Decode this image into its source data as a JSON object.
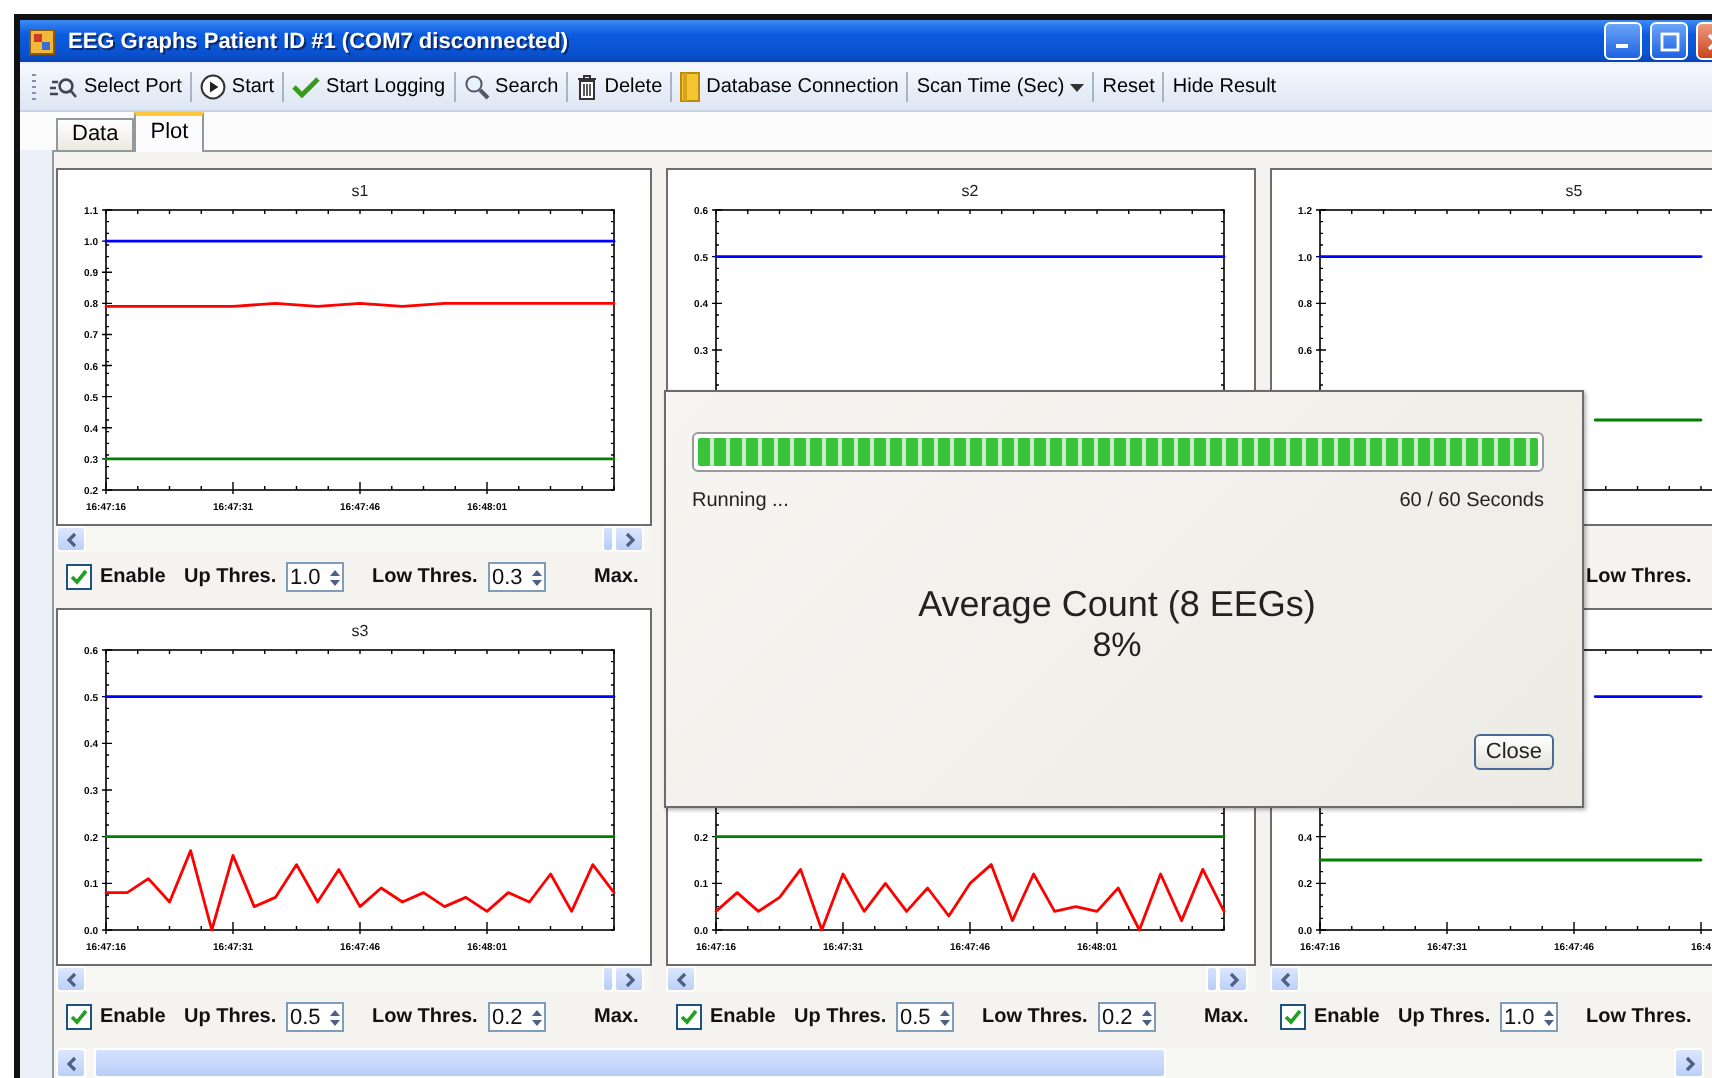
{
  "window": {
    "title": "EEG Graphs Patient ID #1 (COM7 disconnected)"
  },
  "toolbar": [
    {
      "kind": "port",
      "label": "Select Port"
    },
    {
      "kind": "start",
      "label": "Start"
    },
    {
      "kind": "logging",
      "label": "Start Logging"
    },
    {
      "kind": "search",
      "label": "Search"
    },
    {
      "kind": "delete",
      "label": "Delete"
    },
    {
      "kind": "database",
      "label": "Database Connection"
    },
    {
      "kind": "dropdown",
      "label": "Scan Time (Sec)"
    },
    {
      "kind": "text",
      "label": "Reset"
    },
    {
      "kind": "text",
      "label": "Hide Result"
    }
  ],
  "tabs": [
    {
      "label": "Data",
      "selected": false
    },
    {
      "label": "Plot",
      "selected": true
    }
  ],
  "plots": [
    {
      "chart_data": {
        "type": "line",
        "title": "s1",
        "categories": [
          "16:47:16",
          null,
          null,
          "16:47:31",
          null,
          null,
          "16:47:46",
          null,
          null,
          "16:48:01",
          null,
          null,
          null
        ],
        "ylim": [
          0.2,
          1.1
        ],
        "yticks": [
          {
            "value": 0.2,
            "label": "0.2"
          },
          {
            "value": 0.3,
            "label": "0.3"
          },
          {
            "value": 0.4,
            "label": "0.4"
          },
          {
            "value": 0.5,
            "label": "0.5"
          },
          {
            "value": 0.6,
            "label": "0.6"
          },
          {
            "value": 0.7,
            "label": "0.7"
          },
          {
            "value": 0.8,
            "label": "0.8"
          },
          {
            "value": 0.9,
            "label": "0.9"
          },
          {
            "value": 1.0,
            "label": "1.0"
          },
          {
            "value": 1.1,
            "label": "1.1"
          }
        ],
        "series": [
          {
            "color": "#0000ff",
            "values": [
              1.0,
              1.0,
              1.0,
              1.0,
              1.0,
              1.0,
              1.0,
              1.0,
              1.0,
              1.0,
              1.0,
              1.0,
              1.0
            ]
          },
          {
            "color": "#008000",
            "values": [
              0.3,
              0.3,
              0.3,
              0.3,
              0.3,
              0.3,
              0.3,
              0.3,
              0.3,
              0.3,
              0.3,
              0.3,
              0.3
            ]
          },
          {
            "color": "#ff0000",
            "values": [
              0.79,
              0.79,
              0.79,
              0.79,
              0.8,
              0.79,
              0.8,
              0.79,
              0.8,
              0.8,
              0.8,
              0.8,
              0.8
            ]
          }
        ]
      },
      "controls": {
        "enable": {
          "label": "Enable",
          "checked": true
        },
        "up": {
          "label": "Up Thres.",
          "value": "1.0"
        },
        "low": {
          "label": "Low Thres.",
          "value": "0.3"
        },
        "max_label": "Max."
      }
    },
    {
      "chart_data": {
        "type": "line",
        "title": "s2",
        "categories": [
          null,
          null,
          null,
          null,
          null,
          null,
          null,
          null,
          null,
          null,
          null,
          null,
          null
        ],
        "ylim": [
          0,
          0.6
        ],
        "yticks": [
          {
            "value": 0.3,
            "label": "0.3"
          },
          {
            "value": 0.4,
            "label": "0.4"
          },
          {
            "value": 0.5,
            "label": "0.5"
          },
          {
            "value": 0.6,
            "label": "0.6"
          }
        ],
        "series": [
          {
            "color": "#0000ff",
            "values": [
              0.5,
              0.5,
              0.5,
              0.5,
              0.5,
              0.5,
              0.5,
              0.5,
              0.5,
              0.5,
              0.5,
              0.5,
              0.5
            ]
          }
        ]
      }
    },
    {
      "chart_data": {
        "type": "line",
        "title": "s5",
        "categories": [
          null,
          null,
          null,
          null,
          null,
          null,
          null,
          null,
          null,
          null,
          null,
          null,
          null,
          null,
          null,
          null,
          null,
          null,
          null,
          null,
          null,
          null,
          null,
          null,
          null
        ],
        "ylim": [
          0,
          1.2
        ],
        "yticks": [
          {
            "value": 0.6,
            "label": "0.6"
          },
          {
            "value": 0.8,
            "label": "0.8"
          },
          {
            "value": 1.0,
            "label": "1.0"
          },
          {
            "value": 1.2,
            "label": "1.2"
          }
        ],
        "series": [
          {
            "color": "#0000ff",
            "values": [
              1.0,
              1.0,
              1.0,
              1.0,
              1.0,
              1.0,
              1.0,
              1.0,
              1.0,
              1.0,
              1.0,
              1.0,
              1.0,
              1.0,
              1.0,
              1.0,
              1.0,
              1.0,
              1.0,
              null,
              null,
              null,
              null,
              null,
              null
            ]
          },
          {
            "color": "#008000",
            "values": [
              null,
              null,
              null,
              null,
              null,
              null,
              null,
              null,
              null,
              null,
              null,
              null,
              null,
              0.3,
              0.3,
              0.3,
              0.3,
              0.3,
              0.3,
              null,
              null,
              null,
              null,
              null,
              null
            ]
          }
        ]
      },
      "controls": {
        "low": {
          "label": "Low Thres."
        }
      }
    },
    {
      "chart_data": {
        "type": "line",
        "title": "s3",
        "categories": [
          "16:47:16",
          null,
          null,
          null,
          null,
          null,
          "16:47:31",
          null,
          null,
          null,
          null,
          null,
          "16:47:46",
          null,
          null,
          null,
          null,
          null,
          "16:48:01",
          null,
          null,
          null,
          null,
          null,
          null
        ],
        "ylim": [
          0,
          0.6
        ],
        "yticks": [
          {
            "value": 0,
            "label": "0.0"
          },
          {
            "value": 0.1,
            "label": "0.1"
          },
          {
            "value": 0.2,
            "label": "0.2"
          },
          {
            "value": 0.3,
            "label": "0.3"
          },
          {
            "value": 0.4,
            "label": "0.4"
          },
          {
            "value": 0.5,
            "label": "0.5"
          },
          {
            "value": 0.6,
            "label": "0.6"
          }
        ],
        "series": [
          {
            "color": "#0000ff",
            "values": [
              0.5,
              0.5,
              0.5,
              0.5,
              0.5,
              0.5,
              0.5,
              0.5,
              0.5,
              0.5,
              0.5,
              0.5,
              0.5,
              0.5,
              0.5,
              0.5,
              0.5,
              0.5,
              0.5,
              0.5,
              0.5,
              0.5,
              0.5,
              0.5,
              0.5
            ]
          },
          {
            "color": "#008000",
            "values": [
              0.2,
              0.2,
              0.2,
              0.2,
              0.2,
              0.2,
              0.2,
              0.2,
              0.2,
              0.2,
              0.2,
              0.2,
              0.2,
              0.2,
              0.2,
              0.2,
              0.2,
              0.2,
              0.2,
              0.2,
              0.2,
              0.2,
              0.2,
              0.2,
              0.2
            ]
          },
          {
            "color": "#ff0000",
            "values": [
              0.08,
              0.08,
              0.11,
              0.06,
              0.17,
              0.0,
              0.16,
              0.05,
              0.07,
              0.14,
              0.06,
              0.13,
              0.05,
              0.09,
              0.06,
              0.08,
              0.05,
              0.07,
              0.04,
              0.08,
              0.06,
              0.12,
              0.04,
              0.14,
              0.08
            ]
          }
        ]
      },
      "controls": {
        "enable": {
          "label": "Enable",
          "checked": true
        },
        "up": {
          "label": "Up Thres.",
          "value": "0.5"
        },
        "low": {
          "label": "Low Thres.",
          "value": "0.2"
        },
        "max_label": "Max."
      }
    },
    {
      "chart_data": {
        "type": "line",
        "categories": [
          "16:47:16",
          null,
          null,
          null,
          null,
          null,
          "16:47:31",
          null,
          null,
          null,
          null,
          null,
          "16:47:46",
          null,
          null,
          null,
          null,
          null,
          "16:48:01",
          null,
          null,
          null,
          null,
          null,
          null
        ],
        "ylim": [
          0,
          0.6
        ],
        "yticks": [
          {
            "value": 0,
            "label": "0.0"
          },
          {
            "value": 0.1,
            "label": "0.1"
          },
          {
            "value": 0.2,
            "label": "0.2"
          }
        ],
        "series": [
          {
            "color": "#008000",
            "values": [
              0.2,
              0.2,
              0.2,
              0.2,
              0.2,
              0.2,
              0.2,
              0.2,
              0.2,
              0.2,
              0.2,
              0.2,
              0.2,
              0.2,
              0.2,
              0.2,
              0.2,
              0.2,
              0.2,
              0.2,
              0.2,
              0.2,
              0.2,
              0.2,
              0.2
            ]
          },
          {
            "color": "#ff0000",
            "values": [
              0.04,
              0.08,
              0.04,
              0.07,
              0.13,
              0.0,
              0.12,
              0.04,
              0.1,
              0.04,
              0.09,
              0.03,
              0.1,
              0.14,
              0.02,
              0.12,
              0.04,
              0.05,
              0.04,
              0.09,
              0.0,
              0.12,
              0.02,
              0.13,
              0.04
            ]
          }
        ]
      },
      "controls": {
        "enable": {
          "label": "Enable",
          "checked": true
        },
        "up": {
          "label": "Up Thres.",
          "value": "0.5"
        },
        "low": {
          "label": "Low Thres.",
          "value": "0.2"
        },
        "max_label": "Max."
      }
    },
    {
      "chart_data": {
        "type": "line",
        "categories": [
          "16:47:16",
          null,
          null,
          null,
          null,
          null,
          "16:47:31",
          null,
          null,
          null,
          null,
          null,
          "16:47:46",
          null,
          null,
          null,
          null,
          null,
          "16:4",
          null,
          null,
          null,
          null,
          null,
          null
        ],
        "ylim": [
          0,
          1.2
        ],
        "yticks": [
          {
            "value": 0,
            "label": "0.0"
          },
          {
            "value": 0.2,
            "label": "0.2"
          },
          {
            "value": 0.4,
            "label": "0.4"
          }
        ],
        "series": [
          {
            "color": "#0000ff",
            "values": [
              null,
              null,
              null,
              null,
              null,
              null,
              null,
              null,
              null,
              null,
              null,
              null,
              null,
              1.0,
              1.0,
              1.0,
              1.0,
              1.0,
              1.0,
              null,
              null,
              null,
              null,
              null,
              null
            ]
          },
          {
            "color": "#008000",
            "values": [
              0.3,
              0.3,
              0.3,
              0.3,
              0.3,
              0.3,
              0.3,
              0.3,
              0.3,
              0.3,
              0.3,
              0.3,
              0.3,
              0.3,
              0.3,
              0.3,
              0.3,
              0.3,
              0.3,
              null,
              null,
              null,
              null,
              null,
              null
            ]
          }
        ]
      },
      "controls": {
        "enable": {
          "label": "Enable",
          "checked": true
        },
        "up": {
          "label": "Up Thres.",
          "value": "1.0"
        },
        "low": {
          "label": "Low Thres."
        }
      }
    }
  ],
  "dialog": {
    "progress": {
      "level": 1
    },
    "status": "Running ...",
    "elapsed": "60 / 60 Seconds",
    "heading": "Average Count (8 EEGs)",
    "value": "8%",
    "button": "Close"
  }
}
